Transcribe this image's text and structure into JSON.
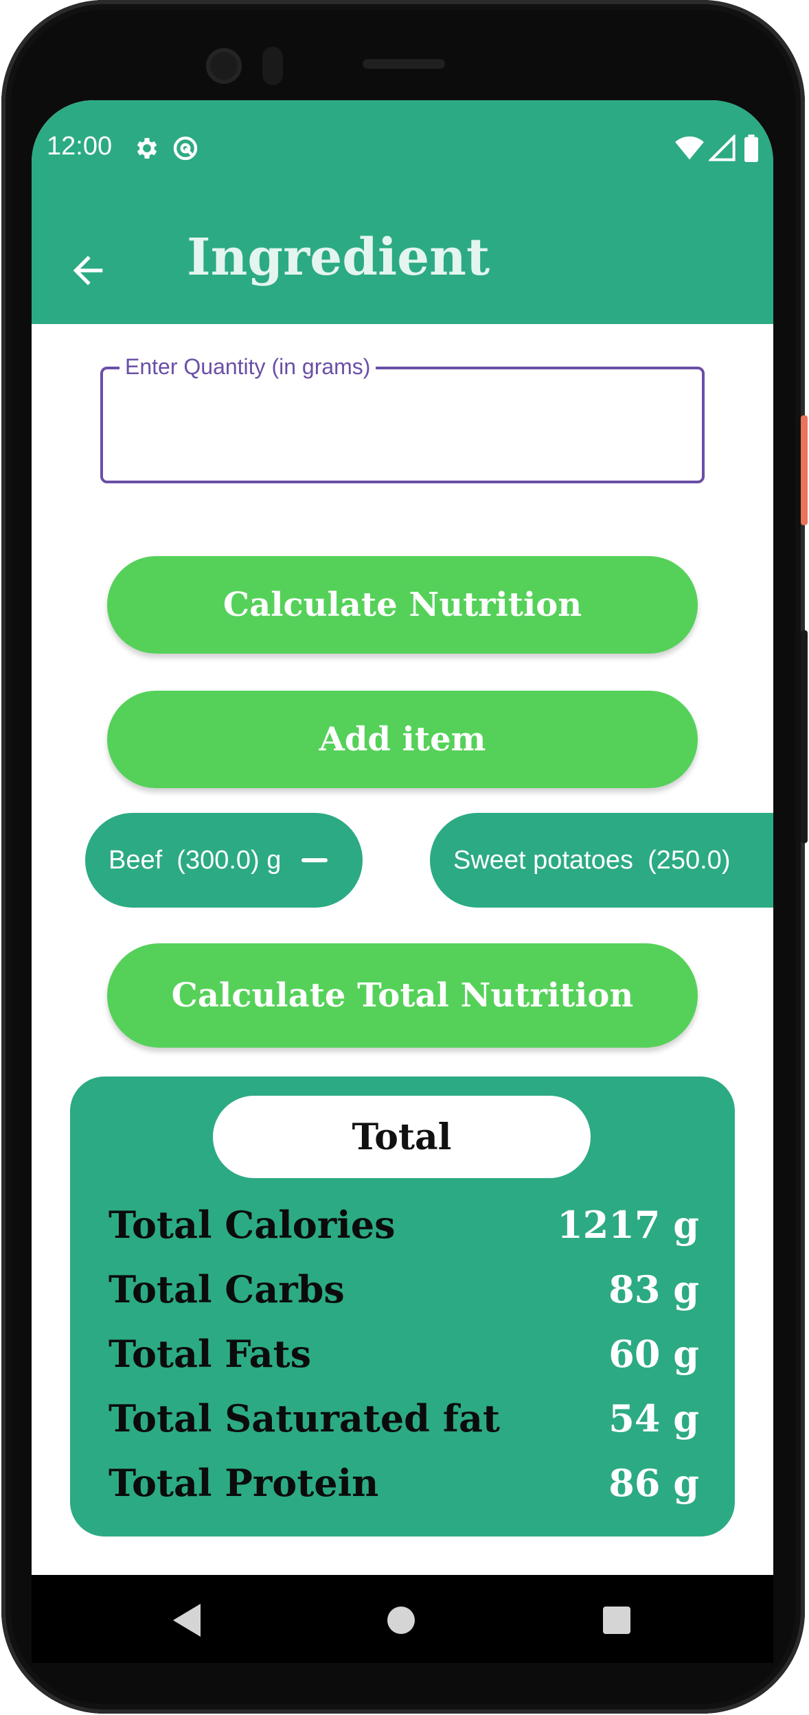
{
  "status_bar": {
    "time": "12:00"
  },
  "app_bar": {
    "title": "Ingredient"
  },
  "quantity_field": {
    "label": "Enter Quantity (in grams)",
    "value": ""
  },
  "buttons": {
    "calculate_nutrition": "Calculate Nutrition",
    "add_item": "Add item",
    "calculate_total": "Calculate Total Nutrition"
  },
  "chips": [
    {
      "label": "Beef  (300.0) g"
    },
    {
      "label": "Sweet potatoes  (250.0)"
    }
  ],
  "total": {
    "heading": "Total",
    "rows": [
      {
        "label": "Total Calories",
        "value": "1217 g"
      },
      {
        "label": "Total Carbs",
        "value": "83 g"
      },
      {
        "label": "Total Fats",
        "value": "60 g"
      },
      {
        "label": "Total Saturated fat",
        "value": "54 g"
      },
      {
        "label": "Total Protein",
        "value": "86 g"
      }
    ]
  },
  "colors": {
    "primary": "#2caa84",
    "button_green": "#55d159",
    "field_outline": "#6a4fa6"
  },
  "icons": [
    "settings-icon",
    "at-sign-icon",
    "wifi-icon",
    "signal-icon",
    "battery-icon",
    "back-arrow-icon",
    "remove-icon",
    "nav-back-icon",
    "nav-home-icon",
    "nav-recents-icon"
  ]
}
